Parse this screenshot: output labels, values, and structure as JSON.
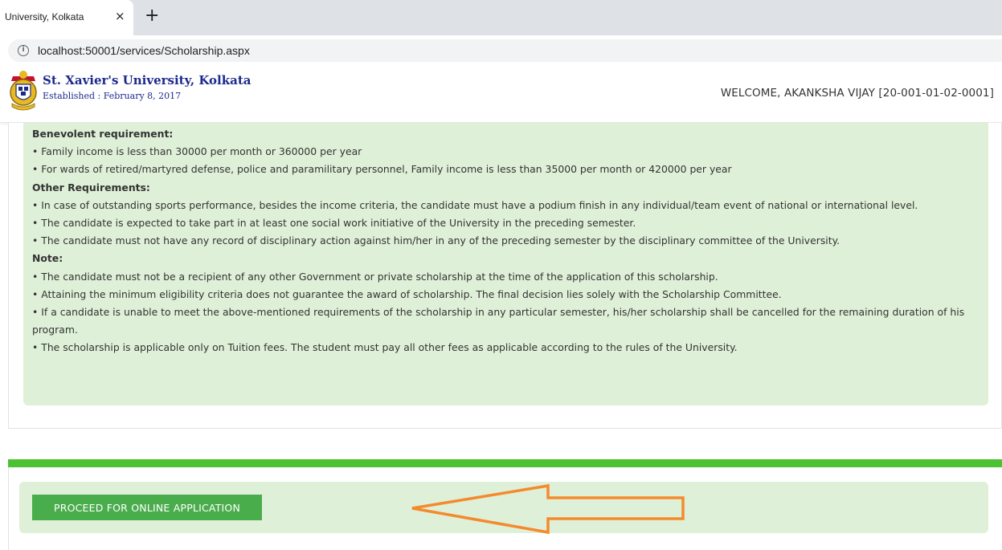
{
  "browser": {
    "tab_title": "University, Kolkata",
    "close_glyph": "×",
    "new_tab_glyph": "+",
    "info_glyph": "i",
    "url": "localhost:50001/services/Scholarship.aspx"
  },
  "header": {
    "university_name": "St. Xavier's University, Kolkata",
    "established": "Established : February 8, 2017",
    "welcome": "WELCOME, AKANKSHA VIJAY [20-001-01-02-0001]"
  },
  "requirements": {
    "benevolent_heading": "Benevolent requirement:",
    "benevolent_items": [
      "• Family income is less than 30000 per month or 360000 per year",
      "• For wards of retired/martyred defense, police and paramilitary personnel, Family income is less than 35000 per month or 420000 per year"
    ],
    "other_heading": "Other Requirements:",
    "other_items": [
      "• In case of outstanding sports performance, besides the income criteria, the candidate must have a podium finish in any individual/team event of national or international level.",
      "• The candidate is expected to take part in at least one social work initiative of the University in the preceding semester.",
      "• The candidate must not have any record of disciplinary action against him/her in any of the preceding semester by the disciplinary committee of the University."
    ],
    "note_heading": "Note:",
    "note_items": [
      "• The candidate must not be a recipient of any other Government or private scholarship at the time of the application of this scholarship.",
      "• Attaining the minimum eligibility criteria does not guarantee the award of scholarship. The final decision lies solely with the Scholarship Committee.",
      "• If a candidate is unable to meet the above-mentioned requirements of the scholarship in any particular semester, his/her scholarship shall be cancelled for the remaining duration of his program.",
      "• The scholarship is applicable only on Tuition fees. The student must pay all other fees as applicable according to the rules of the University."
    ]
  },
  "action": {
    "proceed_label": "PROCEED FOR ONLINE APPLICATION"
  },
  "colors": {
    "panel_green": "#dff0d8",
    "bar_green": "#4cc232",
    "button_green": "#4aad4c",
    "arrow_orange": "#f58a2c",
    "brand_blue": "#1c2a8c"
  }
}
